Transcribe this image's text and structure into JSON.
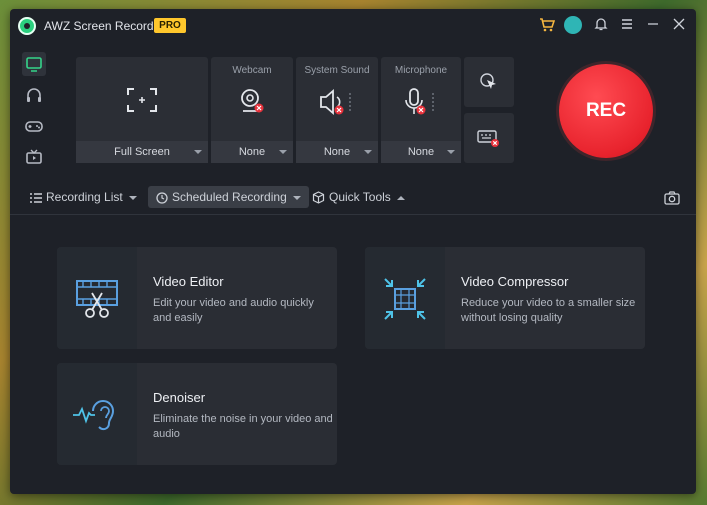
{
  "app": {
    "title": "AWZ Screen Recorder",
    "badge": "PRO"
  },
  "titlebar_icons": [
    "cart-icon",
    "avatar",
    "bell-icon",
    "menu-icon",
    "minimize-icon",
    "close-icon"
  ],
  "sidebar": {
    "items": [
      {
        "icon": "monitor-icon",
        "active": true
      },
      {
        "icon": "headphones-icon",
        "active": false
      },
      {
        "icon": "gamepad-icon",
        "active": false
      },
      {
        "icon": "tv-icon",
        "active": false
      }
    ]
  },
  "sources": {
    "screen": {
      "value": "Full Screen"
    },
    "webcam": {
      "label": "Webcam",
      "value": "None"
    },
    "system_sound": {
      "label": "System Sound",
      "value": "None"
    },
    "microphone": {
      "label": "Microphone",
      "value": "None"
    }
  },
  "rec_label": "REC",
  "toolbar": {
    "recording_list": "Recording List",
    "scheduled_recording": "Scheduled Recording",
    "quick_tools": "Quick Tools"
  },
  "tools": [
    {
      "title": "Video Editor",
      "desc": "Edit your video and audio quickly and easily"
    },
    {
      "title": "Video Compressor",
      "desc": "Reduce your video to a smaller size without losing quality"
    },
    {
      "title": "Denoiser",
      "desc": "Eliminate the noise in your video and audio"
    }
  ],
  "colors": {
    "accent_green": "#35d48a",
    "rec_red": "#e8232d",
    "pro_yellow": "#ffc72c"
  }
}
